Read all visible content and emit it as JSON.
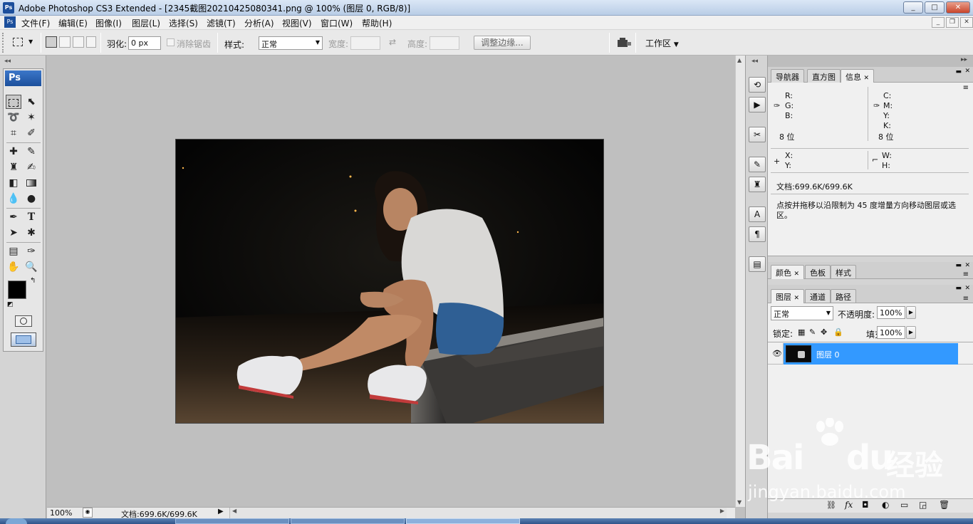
{
  "window": {
    "app_badge": "Ps",
    "title": "Adobe Photoshop CS3 Extended - [2345截图20210425080341.png @ 100% (图层 0, RGB/8)]",
    "minimize": "_",
    "maximize": "□",
    "close": "✕"
  },
  "menu": [
    "文件(F)",
    "编辑(E)",
    "图像(I)",
    "图层(L)",
    "选择(S)",
    "滤镜(T)",
    "分析(A)",
    "视图(V)",
    "窗口(W)",
    "帮助(H)"
  ],
  "options": {
    "feather_label": "羽化:",
    "feather_value": "0 px",
    "antialias_label": "消除锯齿",
    "style_label": "样式:",
    "style_value": "正常",
    "width_label": "宽度:",
    "height_label": "高度:",
    "refine_button": "调整边缘...",
    "workspace_label": "工作区"
  },
  "toolbox": {
    "logo": "Ps"
  },
  "status": {
    "zoom": "100%",
    "doc": "文档:699.6K/699.6K"
  },
  "info_panel": {
    "tabs": [
      "导航器",
      "直方图",
      "信息"
    ],
    "rgb": [
      "R:",
      "G:",
      "B:"
    ],
    "cmyk": [
      "C:",
      "M:",
      "Y:",
      "K:"
    ],
    "bits_left": "8 位",
    "bits_right": "8 位",
    "xy": [
      "X:",
      "Y:"
    ],
    "wh": [
      "W:",
      "H:"
    ],
    "doc": "文档:699.6K/699.6K",
    "hint": "点按并拖移以沿限制为 45 度增量方向移动图层或选区。"
  },
  "color_panel": {
    "tabs": [
      "颜色",
      "色板",
      "样式"
    ]
  },
  "layers_panel": {
    "tabs": [
      "图层",
      "通道",
      "路径"
    ],
    "blend_mode": "正常",
    "opacity_label": "不透明度:",
    "opacity_value": "100%",
    "lock_label": "锁定:",
    "fill_label": "填充:",
    "fill_value": "100%",
    "layer_name": "图层 0"
  },
  "watermark": {
    "brand": "Bai",
    "brand2": "du",
    "cn": "经验",
    "url": "jingyan.baidu.com"
  },
  "colors": {
    "accent": "#3399ff",
    "fg": "#000000",
    "bg": "#4a7d4f"
  }
}
